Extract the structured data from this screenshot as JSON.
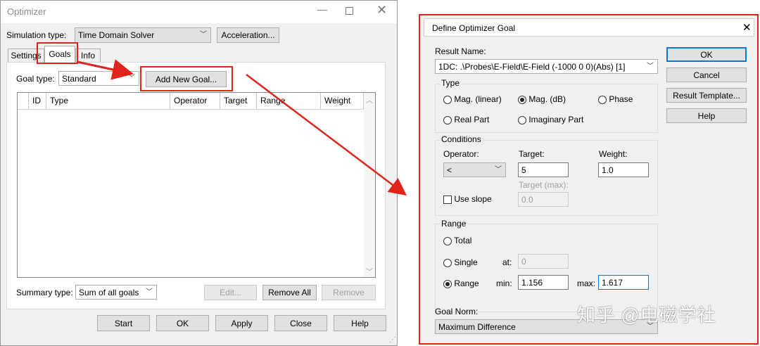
{
  "optimizer": {
    "title": "Optimizer",
    "simulation_type_label": "Simulation type:",
    "simulation_type_value": "Time Domain Solver",
    "acceleration_button": "Acceleration...",
    "tabs": [
      "Settings",
      "Goals",
      "Info"
    ],
    "goal_type_label": "Goal type:",
    "goal_type_value": "Standard",
    "add_goal_button": "Add New Goal...",
    "columns": [
      "ID",
      "Type",
      "Operator",
      "Target",
      "Range",
      "Weight"
    ],
    "summary_type_label": "Summary type:",
    "summary_type_value": "Sum of all goals",
    "edit_button": "Edit...",
    "remove_all_button": "Remove All",
    "remove_button": "Remove",
    "bottom_buttons": [
      "Start",
      "OK",
      "Apply",
      "Close",
      "Help"
    ]
  },
  "goal_dialog": {
    "title": "Define Optimizer Goal",
    "result_name_label": "Result Name:",
    "result_name_value": "1DC: .\\Probes\\E-Field\\E-Field (-1000 0 0)(Abs) [1]",
    "type_group": "Type",
    "type_options": [
      "Mag. (linear)",
      "Mag. (dB)",
      "Phase",
      "Real Part",
      "Imaginary Part"
    ],
    "conditions_group": "Conditions",
    "operator_label": "Operator:",
    "operator_value": "<",
    "target_label": "Target:",
    "target_value": "5",
    "weight_label": "Weight:",
    "weight_value": "1.0",
    "target_max_label": "Target (max):",
    "target_max_value": "0.0",
    "use_slope_label": "Use slope",
    "range_group": "Range",
    "range_total": "Total",
    "range_single": "Single",
    "at_label": "at:",
    "at_value": "0",
    "range_range": "Range",
    "min_label": "min:",
    "min_value": "1.156",
    "max_label": "max:",
    "max_value": "1.617",
    "goal_norm_label": "Goal Norm:",
    "goal_norm_value": "Maximum Difference",
    "buttons": [
      "OK",
      "Cancel",
      "Result Template...",
      "Help"
    ]
  },
  "watermark": "知乎 @电磁学社",
  "colors": {
    "annotation_red": "#e0241c",
    "accent_blue": "#0078d7"
  }
}
